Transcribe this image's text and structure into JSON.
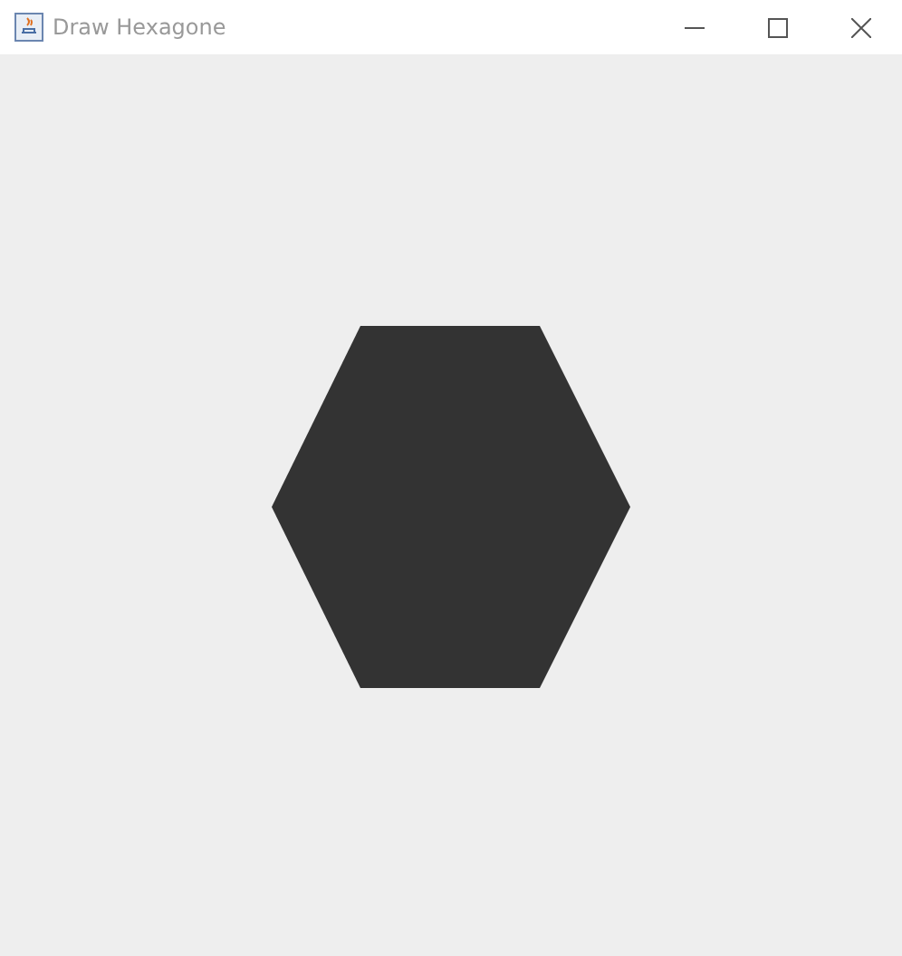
{
  "window": {
    "title": "Draw Hexagone"
  }
}
